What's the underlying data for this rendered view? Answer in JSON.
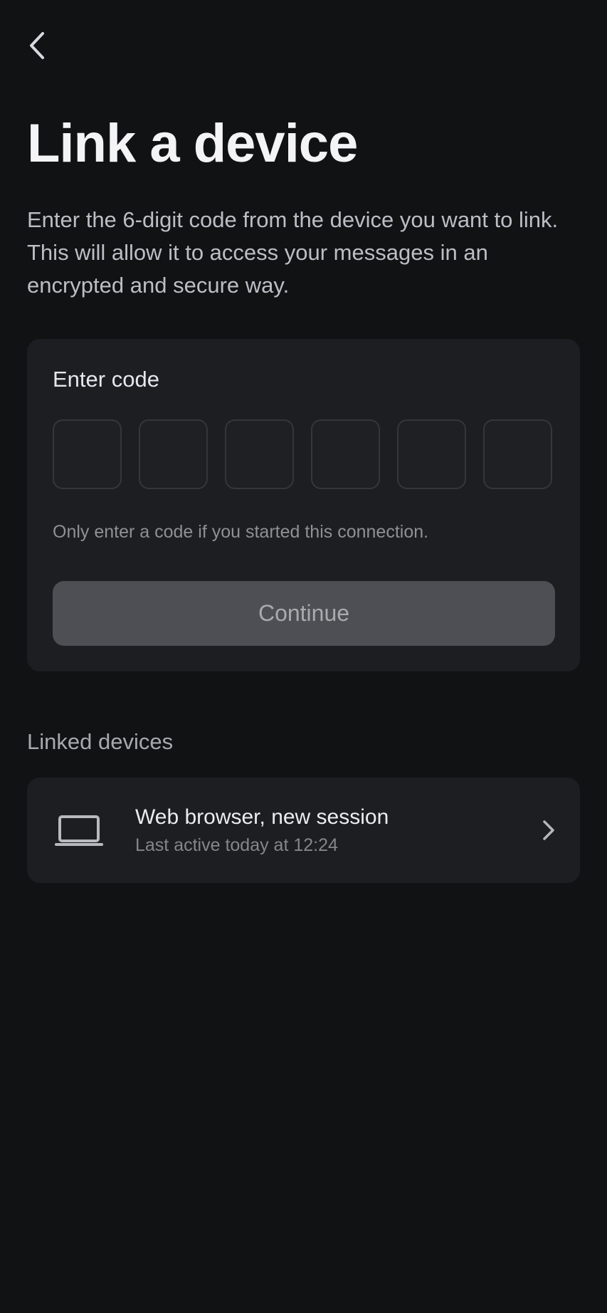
{
  "header": {
    "back_icon": "chevron-left-icon"
  },
  "page": {
    "title": "Link a device",
    "description": "Enter the 6-digit code from the device you want to link. This will allow it to access your messages in an encrypted and secure way."
  },
  "code_entry": {
    "label": "Enter code",
    "digits": [
      "",
      "",
      "",
      "",
      "",
      ""
    ],
    "note": "Only enter a code if you started this connection.",
    "continue_label": "Continue"
  },
  "linked_devices": {
    "section_label": "Linked devices",
    "items": [
      {
        "icon": "laptop-icon",
        "name": "Web browser, new session",
        "last_active": "Last active today at 12:24",
        "chevron_icon": "chevron-right-icon"
      }
    ]
  },
  "colors": {
    "background": "#111214",
    "card": "#1d1e21",
    "button_disabled": "#4d4f54"
  }
}
